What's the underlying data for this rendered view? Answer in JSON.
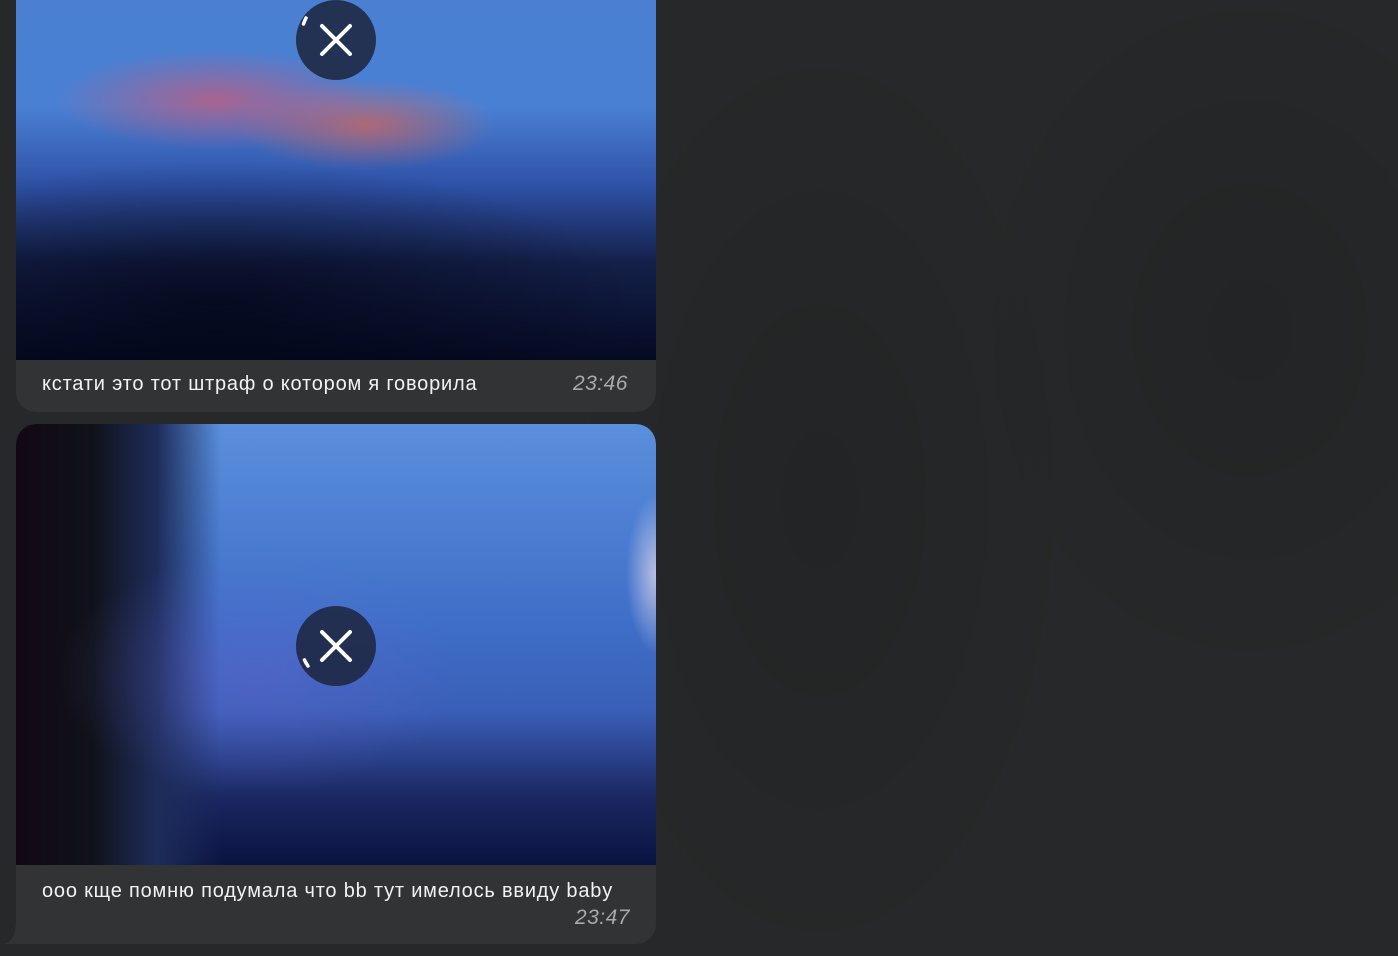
{
  "messages": [
    {
      "caption": "кстати это тот штраф о котором я говорила",
      "time": "23:46",
      "media_action": "cancel-download"
    },
    {
      "caption": "ооо кще помню подумала что bb тут имелось ввиду baby",
      "time": "23:47",
      "media_action": "cancel-download"
    }
  ],
  "colors": {
    "background": "#262829",
    "bubble": "#323334",
    "caption_text": "#f2f2f2",
    "time_text": "#a7a9ad"
  },
  "icons": {
    "cancel": "close-icon",
    "progress": "progress-ring-icon"
  }
}
